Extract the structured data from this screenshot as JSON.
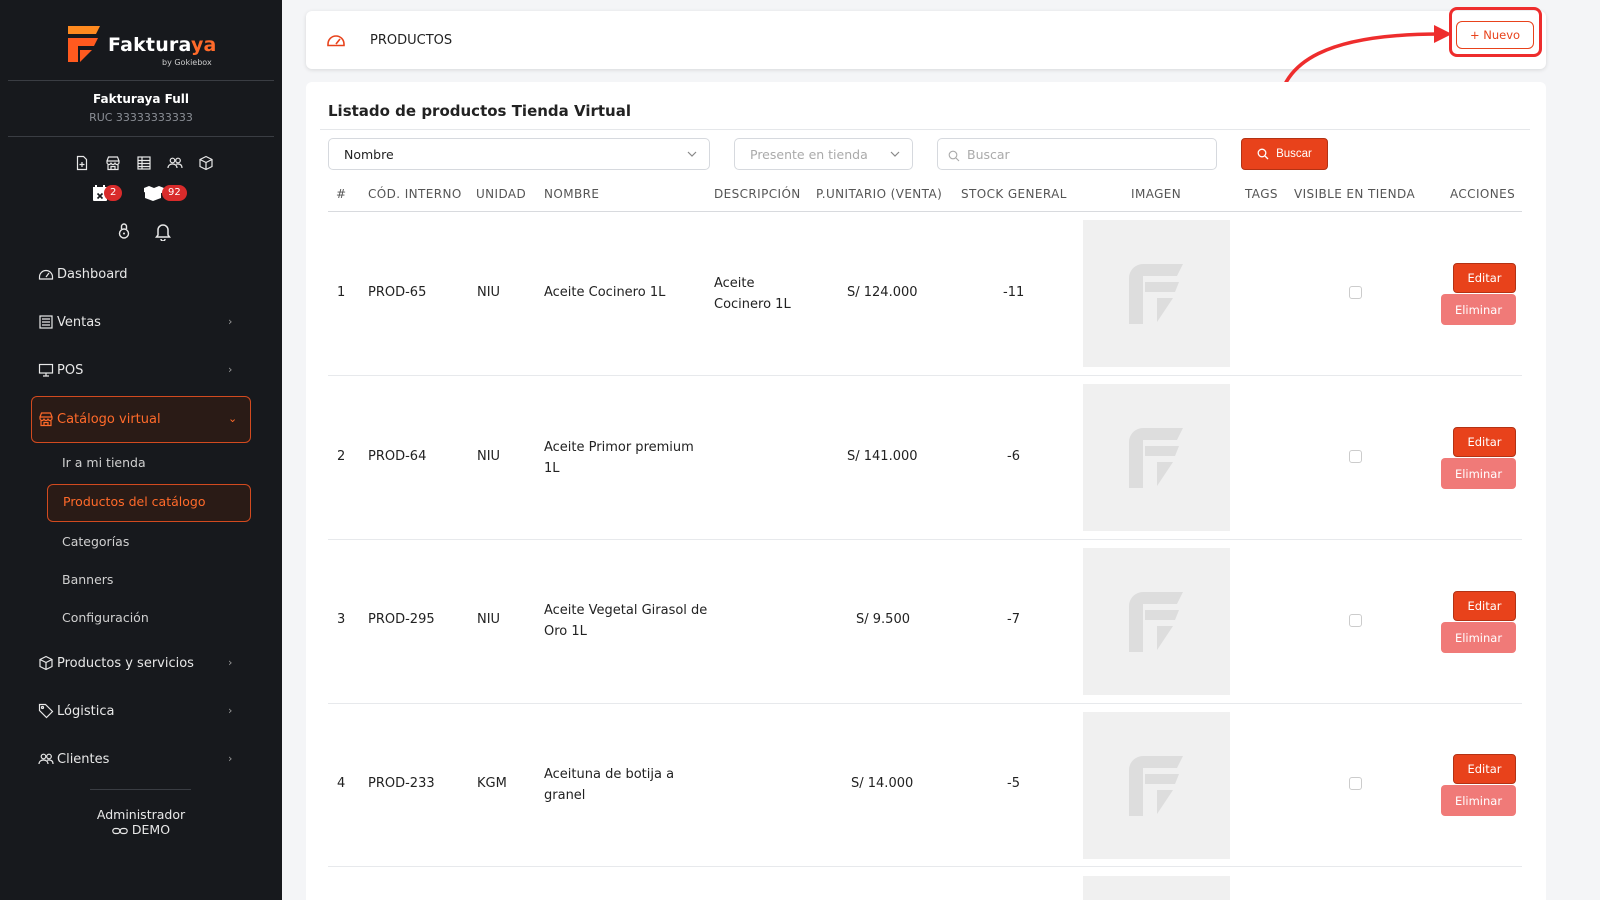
{
  "brand": {
    "logo_prefix": "Faktura",
    "logo_accent": "ya",
    "logo_sub": "by Gokiebox",
    "accent_color": "#e8421b"
  },
  "account": {
    "company": "Fakturaya Full",
    "ruc": "RUC 33333333333"
  },
  "quick_icons": [
    "file-add-icon",
    "store-icon",
    "table-icon",
    "users-icon",
    "box-icon"
  ],
  "badges": {
    "calendar": "2",
    "packages": "92"
  },
  "nav": {
    "dashboard": "Dashboard",
    "ventas": "Ventas",
    "pos": "POS",
    "catalogo": "Catálogo virtual",
    "sub": {
      "ir_tienda": "Ir a mi tienda",
      "productos_catalogo": "Productos del catálogo",
      "categorias": "Categorías",
      "banners": "Banners",
      "configuracion": "Configuración"
    },
    "productos_servicios": "Productos y servicios",
    "logistica": "Lógistica",
    "clientes": "Clientes"
  },
  "user": {
    "role": "Administrador",
    "name": "DEMO"
  },
  "header": {
    "title": "PRODUCTOS",
    "new_button": "+ Nuevo"
  },
  "list": {
    "title": "Listado de productos Tienda Virtual",
    "filter_field": "Nombre",
    "filter_store_placeholder": "Presente en tienda",
    "search_placeholder": "Buscar",
    "search_button": "Buscar"
  },
  "table": {
    "columns": [
      "#",
      "CÓD. INTERNO",
      "UNIDAD",
      "NOMBRE",
      "DESCRIPCIÓN",
      "P.UNITARIO (VENTA)",
      "STOCK GENERAL",
      "IMAGEN",
      "TAGS",
      "VISIBLE EN TIENDA",
      "ACCIONES"
    ],
    "rows": [
      {
        "n": "1",
        "code": "PROD-65",
        "unit": "NIU",
        "name_l1": "Aceite Cocinero 1L",
        "name_l2": "",
        "desc_l1": "Aceite",
        "desc_l2": "Cocinero 1L",
        "price": "S/ 124.000",
        "stock": "-11",
        "edit": "Editar",
        "delete": "Eliminar"
      },
      {
        "n": "2",
        "code": "PROD-64",
        "unit": "NIU",
        "name_l1": "Aceite Primor premium",
        "name_l2": "1L",
        "desc_l1": "",
        "desc_l2": "",
        "price": "S/ 141.000",
        "stock": "-6",
        "edit": "Editar",
        "delete": "Eliminar"
      },
      {
        "n": "3",
        "code": "PROD-295",
        "unit": "NIU",
        "name_l1": "Aceite Vegetal Girasol de",
        "name_l2": "Oro 1L",
        "desc_l1": "",
        "desc_l2": "",
        "price": "S/ 9.500",
        "stock": "-7",
        "edit": "Editar",
        "delete": "Eliminar"
      },
      {
        "n": "4",
        "code": "PROD-233",
        "unit": "KGM",
        "name_l1": "Aceituna de botija a",
        "name_l2": "granel",
        "desc_l1": "",
        "desc_l2": "",
        "price": "S/ 14.000",
        "stock": "-5",
        "edit": "Editar",
        "delete": "Eliminar"
      }
    ]
  }
}
